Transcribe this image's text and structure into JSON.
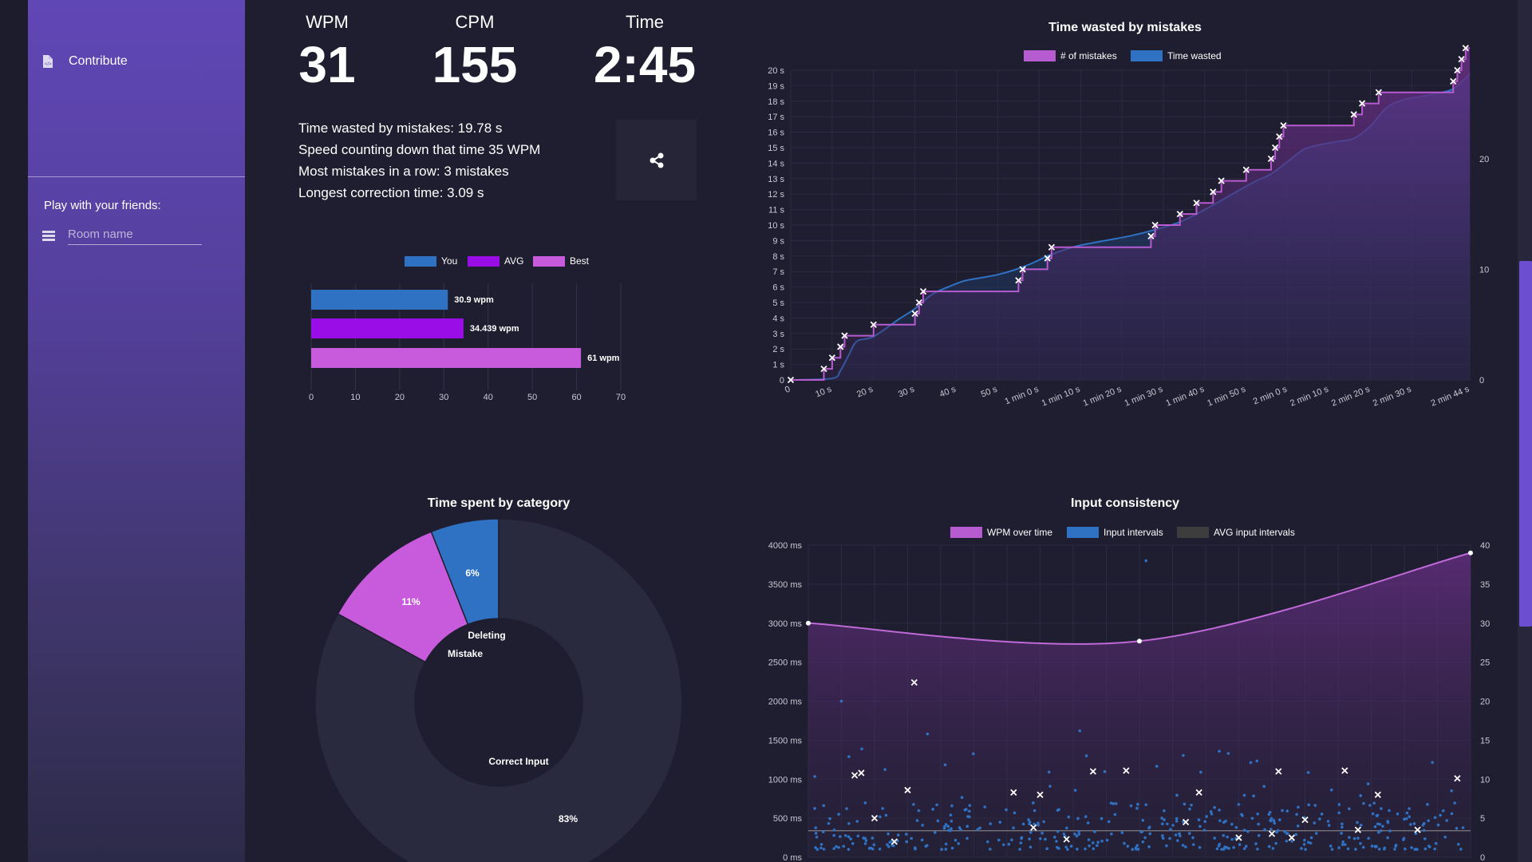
{
  "sidebar": {
    "contribute_label": "Contribute",
    "friends_label": "Play with your friends:",
    "room_placeholder": "Room name"
  },
  "stats": [
    {
      "label": "WPM",
      "value": "31"
    },
    {
      "label": "CPM",
      "value": "155"
    },
    {
      "label": "Time",
      "value": "2:45"
    }
  ],
  "details": [
    "Time wasted by mistakes: 19.78 s",
    "Speed counting down that time 35 WPM",
    "Most mistakes in a row: 3 mistakes",
    "Longest correction time: 3.09 s"
  ],
  "icons": {
    "share": "share-icon",
    "contribute": "file-code-icon",
    "room": "list-icon"
  },
  "colors": {
    "you": "#2f72c4",
    "avg": "#9b0de6",
    "best": "#c85bdc",
    "mistakes": "#b65bd0",
    "wasted": "#2f72c4",
    "avg_intervals": "#3d3d3d"
  },
  "chart_data": [
    {
      "type": "bar",
      "orientation": "horizontal",
      "legend": [
        "You",
        "AVG",
        "Best"
      ],
      "categories": [
        "You",
        "AVG",
        "Best"
      ],
      "values": [
        30.9,
        34.439,
        61
      ],
      "data_labels": [
        "30.9 wpm",
        "34.439 wpm",
        "61 wpm"
      ],
      "xlim": [
        0,
        70
      ],
      "x_ticks": [
        "0",
        "10",
        "20",
        "30",
        "40",
        "50",
        "60",
        "70"
      ],
      "grid": true
    },
    {
      "type": "area",
      "title": "Time wasted by mistakes",
      "legend": [
        "# of mistakes",
        "Time wasted"
      ],
      "x_ticks": [
        "0",
        "10 s",
        "20 s",
        "30 s",
        "40 s",
        "50 s",
        "1 min 0 s",
        "1 min 10 s",
        "1 min 20 s",
        "1 min 30 s",
        "1 min 40 s",
        "1 min 50 s",
        "2 min 0 s",
        "2 min 10 s",
        "2 min 20 s",
        "2 min 30 s",
        "2 min 44 s"
      ],
      "y_ticks": [
        "0",
        "1 s",
        "2 s",
        "3 s",
        "4 s",
        "5 s",
        "6 s",
        "7 s",
        "8 s",
        "9 s",
        "10 s",
        "11 s",
        "12 s",
        "13 s",
        "14 s",
        "15 s",
        "16 s",
        "17 s",
        "18 s",
        "19 s",
        "20 s"
      ],
      "y2_ticks": [
        "0",
        "10",
        "20"
      ],
      "ylim": [
        0,
        20
      ],
      "y2lim": [
        0,
        28
      ],
      "series": [
        {
          "name": "Time wasted",
          "axis": "left",
          "x": [
            0,
            10,
            12,
            14,
            16,
            20,
            26,
            30,
            34,
            38,
            42,
            46,
            50,
            54,
            58,
            62,
            66,
            70,
            76,
            82,
            88,
            94,
            100,
            106,
            112,
            116,
            120,
            124,
            128,
            132,
            136,
            140,
            144,
            148,
            152,
            156,
            160,
            164
          ],
          "y": [
            0,
            0.1,
            0.6,
            1.6,
            2.5,
            2.8,
            3.9,
            4.6,
            5.5,
            6.0,
            6.4,
            6.6,
            6.8,
            7.1,
            7.5,
            8.0,
            8.4,
            8.7,
            9.0,
            9.3,
            9.7,
            10.2,
            11.0,
            11.9,
            12.8,
            13.3,
            14.1,
            14.9,
            15.2,
            15.4,
            15.6,
            16.4,
            17.6,
            18.1,
            18.3,
            18.5,
            18.8,
            19.78
          ]
        },
        {
          "name": "# of mistakes",
          "axis": "right",
          "x": [
            0,
            8,
            10,
            12,
            13,
            20,
            30,
            31,
            32,
            55,
            56,
            62,
            63,
            87,
            88,
            94,
            98,
            102,
            104,
            110,
            116,
            117,
            118,
            119,
            136,
            138,
            142,
            160,
            161,
            162,
            163
          ],
          "y": [
            0,
            1,
            2,
            3,
            4,
            5,
            6,
            7,
            8,
            9,
            10,
            11,
            12,
            13,
            14,
            15,
            16,
            17,
            18,
            19,
            20,
            21,
            22,
            23,
            24,
            25,
            26,
            27,
            28,
            29,
            30
          ]
        }
      ],
      "grid": true,
      "legend_position": "top"
    },
    {
      "type": "pie",
      "title": "Time spent by category",
      "categories": [
        "Deleting",
        "Mistake",
        "Correct Input"
      ],
      "values": [
        6,
        11,
        83
      ],
      "data_labels": [
        "6%",
        "11%",
        "83%"
      ],
      "legend_position": "none"
    },
    {
      "type": "line",
      "title": "Input consistency",
      "legend": [
        "WPM over time",
        "Input intervals",
        "AVG input intervals"
      ],
      "y_ticks": [
        "0 ms",
        "500 ms",
        "1000 ms",
        "1500 ms",
        "2000 ms",
        "2500 ms",
        "3000 ms",
        "3500 ms",
        "4000 ms"
      ],
      "y2_ticks": [
        "0",
        "5",
        "10",
        "15",
        "20",
        "25",
        "30",
        "35",
        "40"
      ],
      "ylim": [
        0,
        4000
      ],
      "y2lim": [
        0,
        40
      ],
      "series": [
        {
          "name": "WPM over time",
          "axis": "right",
          "x": [
            0,
            0.5,
            1
          ],
          "y": [
            30,
            27.7,
            39
          ]
        },
        {
          "name": "AVG input intervals",
          "axis": "left",
          "value": 340
        },
        {
          "name": "Input intervals",
          "axis": "left",
          "type": "scatter",
          "count": 420,
          "typical_range": [
            100,
            700
          ]
        }
      ],
      "grid": true,
      "legend_position": "top"
    }
  ]
}
